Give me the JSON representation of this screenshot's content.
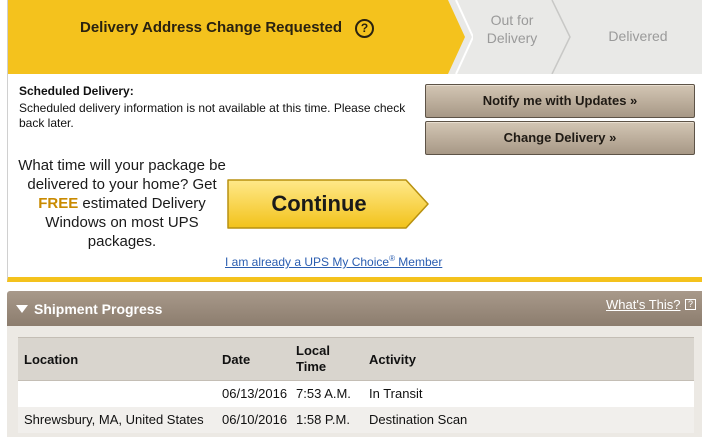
{
  "progress": {
    "steps": [
      {
        "label": "Delivery Address Change Requested",
        "state": "active"
      },
      {
        "label_line1": "Out for",
        "label_line2": "Delivery",
        "state": "inactive"
      },
      {
        "label": "Delivered",
        "state": "inactive"
      }
    ],
    "help_glyph": "?"
  },
  "scheduled": {
    "title": "Scheduled Delivery:",
    "text": "Scheduled delivery information is not available at this time. Please check back later."
  },
  "buttons": {
    "notify": "Notify me with Updates »",
    "change": "Change Delivery »",
    "continue": "Continue"
  },
  "promo": {
    "line_a": "What time will your package be delivered to your home? Get ",
    "free": "FREE",
    "line_b": " estimated Delivery Windows on most UPS packages."
  },
  "member_link": {
    "text": "I am already a UPS My Choice",
    "reg": "®",
    "suffix": " Member"
  },
  "shipment": {
    "title": "Shipment Progress",
    "whats_this": "What's This?",
    "columns": [
      "Location",
      "Date",
      "Local Time",
      "Activity"
    ],
    "rows": [
      {
        "location": "",
        "date": "06/13/2016",
        "time": "7:53 A.M.",
        "activity": "In Transit"
      },
      {
        "location": "Shrewsbury, MA, United States",
        "date": "06/10/2016",
        "time": "1:58 P.M.",
        "activity": "Destination Scan"
      }
    ]
  },
  "colors": {
    "accent_yellow": "#f4c21d",
    "header_brown": "#9c8d7e",
    "link_blue": "#2a5db0"
  }
}
